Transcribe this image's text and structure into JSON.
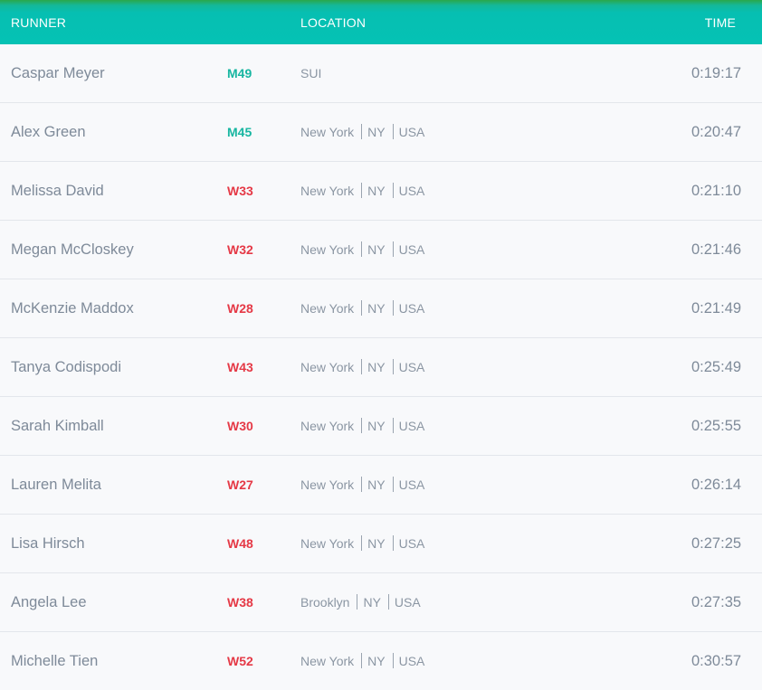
{
  "header": {
    "runner": "RUNNER",
    "location": "LOCATION",
    "time": "TIME"
  },
  "colors": {
    "header_bg": "#05c2b4",
    "header_top_accent": "#2aa84a",
    "men_category": "#17b6a1",
    "women_category": "#e53946"
  },
  "rows": [
    {
      "name": "Caspar Meyer",
      "category": "M49",
      "gender": "m",
      "city": "",
      "state": "",
      "country": "SUI",
      "time": "0:19:17"
    },
    {
      "name": "Alex Green",
      "category": "M45",
      "gender": "m",
      "city": "New York",
      "state": "NY",
      "country": "USA",
      "time": "0:20:47"
    },
    {
      "name": "Melissa David",
      "category": "W33",
      "gender": "w",
      "city": "New York",
      "state": "NY",
      "country": "USA",
      "time": "0:21:10"
    },
    {
      "name": "Megan McCloskey",
      "category": "W32",
      "gender": "w",
      "city": "New York",
      "state": "NY",
      "country": "USA",
      "time": "0:21:46"
    },
    {
      "name": "McKenzie Maddox",
      "category": "W28",
      "gender": "w",
      "city": "New York",
      "state": "NY",
      "country": "USA",
      "time": "0:21:49"
    },
    {
      "name": "Tanya Codispodi",
      "category": "W43",
      "gender": "w",
      "city": "New York",
      "state": "NY",
      "country": "USA",
      "time": "0:25:49"
    },
    {
      "name": "Sarah Kimball",
      "category": "W30",
      "gender": "w",
      "city": "New York",
      "state": "NY",
      "country": "USA",
      "time": "0:25:55"
    },
    {
      "name": "Lauren Melita",
      "category": "W27",
      "gender": "w",
      "city": "New York",
      "state": "NY",
      "country": "USA",
      "time": "0:26:14"
    },
    {
      "name": "Lisa Hirsch",
      "category": "W48",
      "gender": "w",
      "city": "New York",
      "state": "NY",
      "country": "USA",
      "time": "0:27:25"
    },
    {
      "name": "Angela Lee",
      "category": "W38",
      "gender": "w",
      "city": "Brooklyn",
      "state": "NY",
      "country": "USA",
      "time": "0:27:35"
    },
    {
      "name": "Michelle Tien",
      "category": "W52",
      "gender": "w",
      "city": "New York",
      "state": "NY",
      "country": "USA",
      "time": "0:30:57"
    }
  ]
}
